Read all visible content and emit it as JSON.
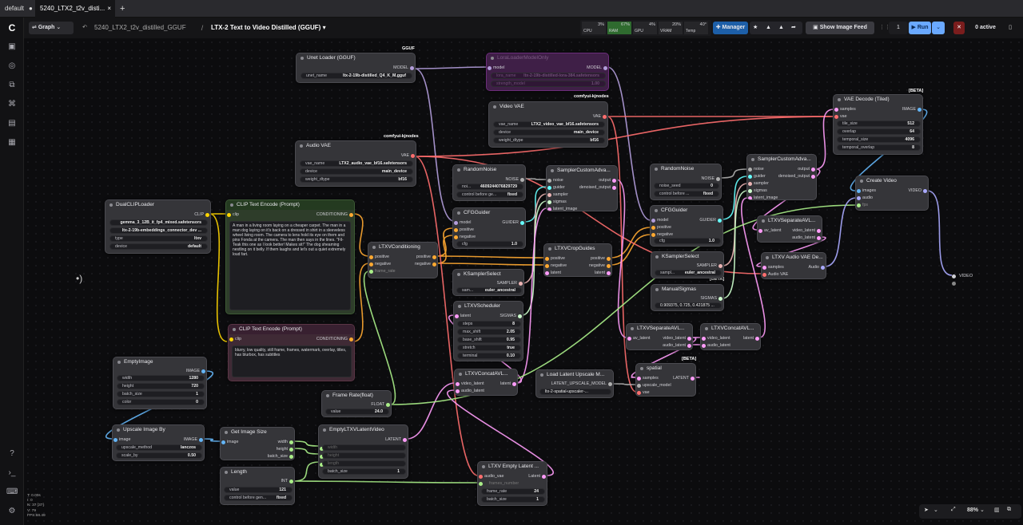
{
  "tabs": {
    "first": "default",
    "active": "5240_LTX2_t2v_disti...",
    "plus": "+"
  },
  "topbar": {
    "mode": "Graph",
    "breadcrumb": "5240_LTX2_t2v_distilled_GGUF",
    "separator": "/",
    "workflow_title": "LTX-2 Text to Video Distilled (GGUF)",
    "cpu_label": "CPU",
    "cpu_val": "3%",
    "ram_label": "RAM",
    "ram_val": "67%",
    "gpu_label": "GPU",
    "gpu_val": "4%",
    "vram_label": "VRAM",
    "vram_val": "20%",
    "temp_label": "Temp",
    "temp_val": "40°",
    "manager": "Manager",
    "show_feed": "Show Image Feed",
    "queue_count": "1",
    "run": "Run",
    "active": "0 active"
  },
  "badges": {
    "gguf": "GGUF",
    "kjnodes1": "comfyui-kjnodes",
    "kjnodes2": "comfyui-kjnodes",
    "kjnodes3": "comfyui-kjnodes",
    "beta1": "[BETA]",
    "beta2": "[BETA]",
    "beta3": "[BETA]"
  },
  "nodes": {
    "unet": {
      "title": "Unet Loader (GGUF)",
      "out": "MODEL",
      "w_label": "unet_name",
      "w_val": "ltx-2-19b-distilled_Q4_K_M.gguf"
    },
    "lora": {
      "title": "LoraLoaderModelOnly",
      "in": "model",
      "out": "MODEL",
      "w1": "lora_name",
      "w1v": "ltx-2-19b-distilled-lora-384.safetensors",
      "w2": "strength_model",
      "w2v": "1.00"
    },
    "vvae": {
      "title": "Video VAE",
      "out": "VAE",
      "w1": "vae_name",
      "w1v": "LTX2_video_vae_bf16.safetensors",
      "w2": "device",
      "w2v": "main_device",
      "w3": "weight_dtype",
      "w3v": "bf16"
    },
    "avae": {
      "title": "Audio VAE",
      "out": "VAE",
      "w1": "vae_name",
      "w1v": "LTX2_audio_vae_bf16.safetensors",
      "w2": "device",
      "w2v": "main_device",
      "w3": "weight_dtype",
      "w3v": "bf16"
    },
    "dclip": {
      "title": "DualCLIPLoader",
      "out": "CLIP",
      "w1v": "gemma_3_12B_it_fp4_mixed.safetensors",
      "w2v": "ltx-2-19b-embeddings_connector_dev ...",
      "w3": "type",
      "w3v": "ltxv",
      "w4": "device",
      "w4v": "default"
    },
    "clippos": {
      "title": "CLIP Text Encode (Prompt)",
      "in": "clip",
      "out": "CONDITIONING",
      "text": "A man in a living room laying on a cheaper carpet. The man in a man dog laying on it's back on a dressed in shirt in a sleeveless wheel living room. The camera to lens hold its eye on them and pins Fonda at the camera. The man then says in the lines. \"Fil-Teak this one as I look better! Makes sit!\" The dog sheaming nestling on it belly. If them laughs and let's out a quiet extremely loud fart."
    },
    "clipneg": {
      "title": "CLIP Text Encode (Prompt)",
      "in": "clip",
      "out": "CONDITIONING",
      "text": "blurry, low quality, still frame, frames, watermark, overlay, titles, has blurbox, has subtitles"
    },
    "ltxcond": {
      "title": "LTXVConditioning",
      "in1": "positive",
      "in2": "negative",
      "in3": "frame_rate",
      "out1": "positive",
      "out2": "negative"
    },
    "rnoise1": {
      "title": "RandomNoise",
      "out": "NOISE",
      "w1": "noi...",
      "w1v": "4609244076829729",
      "w2": "control before ge...",
      "w2v": "fixed"
    },
    "scadv1": {
      "title": "SamplerCustomAdva...",
      "in1": "noise",
      "in2": "guider",
      "in3": "sampler",
      "in4": "sigmas",
      "in5": "latent_image",
      "out1": "output",
      "out2": "denoised_output"
    },
    "cfg1": {
      "title": "CFGGuider",
      "in1": "model",
      "in2": "positive",
      "in3": "negative",
      "out": "GUIDER",
      "w": "cfg",
      "wv": "1.0"
    },
    "ksel1": {
      "title": "KSamplerSelect",
      "out": "SAMPLER",
      "w": "sam...",
      "wv": "euler_ancestral"
    },
    "sched": {
      "title": "LTXVScheduler",
      "in": "latent",
      "out": "SIGMAS",
      "r1": "steps",
      "r1v": "8",
      "r2": "max_shift",
      "r2v": "2.05",
      "r3": "base_shift",
      "r3v": "0.95",
      "r4": "stretch",
      "r4v": "true",
      "r5": "terminal",
      "r5v": "0.10"
    },
    "concat1": {
      "title": "LTXVConcatAVL...",
      "in1": "video_latent",
      "in2": "audio_latent",
      "out": "latent"
    },
    "frate": {
      "title": "Frame Rate(float)",
      "out": "FLOAT",
      "w": "value",
      "wv": "24.0"
    },
    "empimg": {
      "title": "EmptyImage",
      "out": "IMAGE",
      "w1": "width",
      "w1v": "1280",
      "w2": "height",
      "w2v": "720",
      "w3": "batch_size",
      "w3v": "1",
      "w4": "color",
      "w4v": "0"
    },
    "upscale": {
      "title": "Upscale Image By",
      "in": "image",
      "out": "IMAGE",
      "w1": "upscale_method",
      "w1v": "lanczos",
      "w2": "scale_by",
      "w2v": "0.50"
    },
    "imgsize": {
      "title": "Get Image Size",
      "in": "image",
      "out1": "width",
      "out2": "height",
      "out3": "batch_size"
    },
    "emplat": {
      "title": "EmptyLTXVLatentVideo",
      "in1": "width",
      "in2": "height",
      "in3": "length",
      "out": "LATENT",
      "w": "batch_size",
      "wv": "1"
    },
    "length": {
      "title": "Length",
      "out": "INT",
      "w1": "value",
      "w1v": "121",
      "w2": "control before gen...",
      "w2v": "fixed"
    },
    "emplataud": {
      "title": "LTXV Empty Latent ...",
      "in": "audio_vae",
      "out": "Latent",
      "w0": "frames_number",
      "w1": "frame_rate",
      "w1v": "24",
      "w2": "batch_size",
      "w2v": "1"
    },
    "cropg": {
      "title": "LTXVCropGuides",
      "in1": "positive",
      "in2": "negative",
      "in3": "latent",
      "out1": "positive",
      "out2": "negative",
      "out3": "latent"
    },
    "rnoise2": {
      "title": "RandomNoise",
      "out": "NOISE",
      "w1": "noise_seed",
      "w1v": "0",
      "w2": "control before ...",
      "w2v": "fixed"
    },
    "cfg2": {
      "title": "CFGGuider",
      "in1": "model",
      "in2": "positive",
      "in3": "negative",
      "out": "GUIDER",
      "w": "cfg",
      "wv": "1.0"
    },
    "ksel2": {
      "title": "KSamplerSelect",
      "out": "SAMPLER",
      "w": "sampl...",
      "wv": "euler_ancestral"
    },
    "msig": {
      "title": "ManualSigmas",
      "out": "SIGMAS",
      "w": "0.909375, 0.725, 0.421875 ..."
    },
    "sep1": {
      "title": "LTXVSeparateAVL...",
      "in": "av_latent",
      "out1": "video_latent",
      "out2": "audio_latent"
    },
    "concat2": {
      "title": "LTXVConcatAVL...",
      "in1": "video_latent",
      "in2": "audio_latent",
      "out": "latent"
    },
    "spatial": {
      "title": "spatial",
      "in1": "samples",
      "in2": "upscale_model",
      "in3": "vae",
      "out": "LATENT"
    },
    "lupl": {
      "title": "Load Latent Upscale M...",
      "out": "LATENT_UPSCALE_MODEL",
      "w": "ltx-2-spatial-upscaler-..."
    },
    "scadv2": {
      "title": "SamplerCustomAdva...",
      "in1": "noise",
      "in2": "guider",
      "in3": "sampler",
      "in4": "sigmas",
      "in5": "latent_image",
      "out1": "output",
      "out2": "denoised_output"
    },
    "sep2": {
      "title": "LTXVSeparateAVL...",
      "in": "av_latent",
      "out1": "video_latent",
      "out2": "audio_latent"
    },
    "audiodec": {
      "title": "LTXV Audio VAE De...",
      "in1": "samples",
      "in2": "Audio VAE",
      "out": "Audio"
    },
    "vaedec": {
      "title": "VAE Decode (Tiled)",
      "in1": "samples",
      "in2": "vae",
      "out": "IMAGE",
      "w1": "tile_size",
      "w1v": "512",
      "w2": "overlap",
      "w2v": "64",
      "w3": "temporal_size",
      "w3v": "4096",
      "w4": "temporal_overlap",
      "w4v": "8"
    },
    "createvid": {
      "title": "Create Video",
      "in1": "images",
      "in2": "audio",
      "in3": "fps",
      "out": "VIDEO"
    },
    "reroute": {
      "out": "VIDEO"
    }
  },
  "stats": {
    "l1": "T: 0.00s",
    "l2": "I: 0",
    "l3": "N: 37 [37]",
    "l4": "V: 79",
    "l5": "FPS:68.49"
  },
  "zoom": "88%",
  "colors": {
    "model": "#b39ddb",
    "clip": "#ffd500",
    "cond": "#ffa931",
    "vae": "#ff6e6e",
    "latent": "#ff9cf9",
    "image": "#64b5f6",
    "float": "#aaee88",
    "int": "#aaee88",
    "noise": "#b0b0b0",
    "guider": "#66ffff",
    "sampler": "#ecb4b4",
    "sigmas": "#cdffcd",
    "audio": "#aaaaff"
  }
}
